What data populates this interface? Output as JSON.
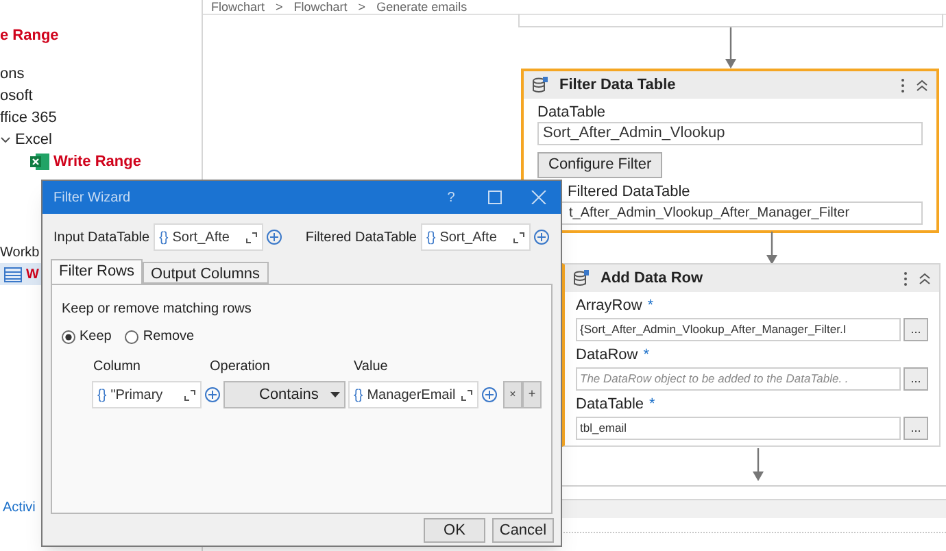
{
  "breadcrumb": {
    "items": [
      "Flowchart",
      "Flowchart",
      "Generate emails"
    ],
    "separator": ">"
  },
  "sidebar": {
    "items": [
      {
        "label": "e Range",
        "kind": "activity"
      },
      {
        "label": "ons",
        "kind": "category"
      },
      {
        "label": "osoft",
        "kind": "category"
      },
      {
        "label": "ffice 365",
        "kind": "category"
      },
      {
        "label": "Excel",
        "kind": "category",
        "expanded": true,
        "children": [
          {
            "label": "Write Range",
            "kind": "excel"
          }
        ]
      }
    ],
    "lower_items": [
      {
        "label": "Workb",
        "kind": "category"
      },
      {
        "label": "W",
        "kind": "workbook"
      }
    ],
    "bottom_tab": "Activi"
  },
  "filter_card": {
    "title": "Filter Data Table",
    "selected": true,
    "datatable_label": "DataTable",
    "datatable_value": "Sort_After_Admin_Vlookup",
    "configure_button": "Configure Filter",
    "filtered_label": "Filtered DataTable",
    "filtered_value": "t_After_Admin_Vlookup_After_Manager_Filter"
  },
  "add_row_card": {
    "title": "Add Data Row",
    "fields": [
      {
        "label": "ArrayRow",
        "required": "*",
        "value": "{Sort_After_Admin_Vlookup_After_Manager_Filter.I",
        "button": "..."
      },
      {
        "label": "DataRow",
        "required": "*",
        "placeholder": "The DataRow object to be added to the DataTable. .",
        "button": "..."
      },
      {
        "label": "DataTable",
        "required": "*",
        "value": "tbl_email",
        "button": "..."
      }
    ]
  },
  "dialog": {
    "title": "Filter Wizard",
    "help": "?",
    "expression_mark": "{}",
    "input_label": "Input DataTable",
    "input_value": "Sort_Afte",
    "output_label": "Filtered DataTable",
    "output_value": "Sort_Afte",
    "tabs": [
      {
        "label": "Filter Rows",
        "selected": true
      },
      {
        "label": "Output Columns",
        "selected": false
      }
    ],
    "instruction": "Keep or remove matching rows",
    "radios": [
      {
        "label": "Keep",
        "selected": true
      },
      {
        "label": "Remove",
        "selected": false
      }
    ],
    "columns": [
      "Column",
      "Operation",
      "Value"
    ],
    "rows": [
      {
        "column": "\"Primary",
        "operation": "Contains",
        "value": "ManagerEmail",
        "remove": "×",
        "add": "+"
      }
    ],
    "buttons": [
      "OK",
      "Cancel"
    ]
  }
}
